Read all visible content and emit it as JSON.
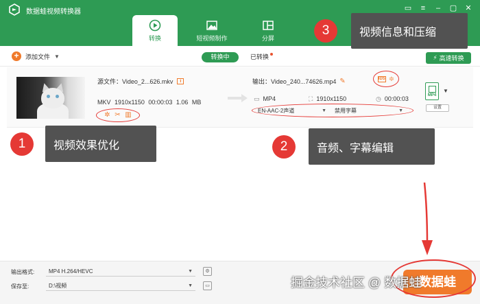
{
  "app": {
    "title": "数据蛙视频转换器"
  },
  "tabs": [
    {
      "label": "转换",
      "icon": "convert-icon"
    },
    {
      "label": "短视频制作",
      "icon": "image-icon"
    },
    {
      "label": "分屏",
      "icon": "split-screen-icon"
    }
  ],
  "toolbar": {
    "add_file": "添加文件",
    "converting": "转换中",
    "converted": "已转换",
    "fast_convert": "高速转换"
  },
  "file": {
    "source_name": "源文件：Video_2...626.mkv",
    "source_meta": "MKV 1910x1150 00:00:03 1.06 MB",
    "output_name": "输出：Video_240...74626.mp4",
    "out_format": "MP4",
    "out_resolution": "1910x1150",
    "out_duration": "00:00:03",
    "audio_track": "EN-AAC-2声道",
    "subtitle": "禁用字幕",
    "format_badge": "MP4",
    "settings": "设置"
  },
  "callouts": {
    "c1_num": "1",
    "c1_text": "视频效果优化",
    "c2_num": "2",
    "c2_text": "音频、字幕编辑",
    "c3_num": "3",
    "c3_text": "视频信息和压缩"
  },
  "bottom": {
    "format_label": "输出格式:",
    "format_value": "MP4 H.264/HEVC",
    "save_label": "保存至:",
    "save_value": "D:\\视频",
    "convert_all": "数据蛙",
    "watermark": "掘金技术社区 @ 数据蛙"
  },
  "colors": {
    "brand_green": "#2e9b54",
    "accent_orange": "#f07a2b",
    "annotation_red": "#e53935"
  }
}
